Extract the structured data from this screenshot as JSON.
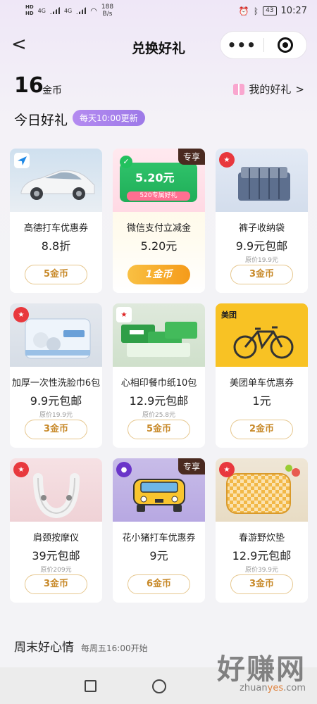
{
  "status_bar": {
    "sig1": "HD",
    "sig2": "HD",
    "net1": "4G",
    "net2": "4G",
    "speed": "188",
    "speed_unit": "B/s",
    "battery": "43",
    "time": "10:27"
  },
  "nav": {
    "back": "<",
    "title": "兑换好礼",
    "more": "•••"
  },
  "coins": {
    "value": "16",
    "unit": "金币",
    "my_gifts": "我的好礼",
    "chevron": ">"
  },
  "today": {
    "title": "今日好礼",
    "badge": "每天10:00更新"
  },
  "products": [
    {
      "title": "高德打车优惠券",
      "price": "8.8折",
      "original": "",
      "button": "5金币",
      "exclusive": "",
      "badge": "navigation-arrow",
      "thumb_text": ""
    },
    {
      "title": "微信支付立减金",
      "price": "5.20元",
      "original": "",
      "button": "1金币",
      "exclusive": "专享",
      "badge": "wechat-check",
      "thumb_text": "5.20元",
      "thumb_sub": "520专属好礼"
    },
    {
      "title": "裤子收纳袋",
      "price": "9.9元包邮",
      "original": "原价19.9元",
      "button": "3金币",
      "exclusive": "",
      "badge": "brand",
      "thumb_text": ""
    },
    {
      "title": "加厚一次性洗脸巾6包",
      "price": "9.9元包邮",
      "original": "原价19.9元",
      "button": "3金币",
      "exclusive": "",
      "badge": "brand",
      "thumb_text": ""
    },
    {
      "title": "心相印餐巾纸10包",
      "price": "12.9元包邮",
      "original": "原价25.8元",
      "button": "5金币",
      "exclusive": "",
      "badge": "brand",
      "thumb_text": ""
    },
    {
      "title": "美团单车优惠券",
      "price": "1元",
      "original": "",
      "button": "2金币",
      "exclusive": "",
      "badge": "",
      "thumb_text": "美团"
    },
    {
      "title": "肩颈按摩仪",
      "price": "39元包邮",
      "original": "原价209元",
      "button": "3金币",
      "exclusive": "",
      "badge": "brand",
      "thumb_text": ""
    },
    {
      "title": "花小猪打车优惠券",
      "price": "9元",
      "original": "",
      "button": "6金币",
      "exclusive": "专享",
      "badge": "pig",
      "thumb_text": ""
    },
    {
      "title": "春游野炊垫",
      "price": "12.9元包邮",
      "original": "原价39.9元",
      "button": "3金币",
      "exclusive": "",
      "badge": "brand",
      "thumb_text": ""
    }
  ],
  "weekend": {
    "title": "周末好心情",
    "subtitle": "每周五16:00开始"
  },
  "watermark": {
    "main": "好赚网",
    "url_a": "zhuan",
    "url_b": "yes",
    "url_c": ".com"
  },
  "colors": {
    "accent_gold": "#c88a2a",
    "badge_purple": "#a583ee",
    "exclusive_brown": "#4a2a20"
  }
}
